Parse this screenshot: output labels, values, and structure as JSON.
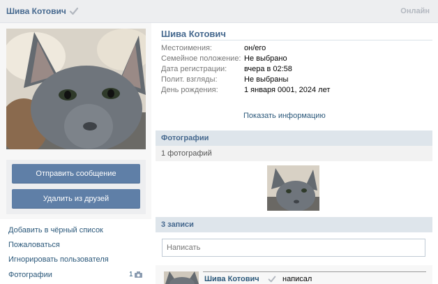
{
  "topbar": {
    "name": "Шива Котович",
    "status": "Онлайн"
  },
  "profile": {
    "name": "Шива Котович",
    "fields": [
      {
        "label": "Местоимения:",
        "value": "он/его"
      },
      {
        "label": "Семейное положение:",
        "value": "Не выбрано"
      },
      {
        "label": "Дата регистрации:",
        "value": "вчера в 02:58"
      },
      {
        "label": "Полит. взгляды:",
        "value": "Не выбраны"
      },
      {
        "label": "День рождения:",
        "value": "1 января 0001, 2024 лет"
      }
    ],
    "show_info": "Показать информацию"
  },
  "actions": {
    "send_message": "Отправить сообщение",
    "remove_friend": "Удалить из друзей"
  },
  "links": {
    "blacklist": "Добавить в чёрный список",
    "report": "Пожаловаться",
    "ignore": "Игнорировать пользователя",
    "photos": "Фотографии",
    "photos_count": "1"
  },
  "photos_section": {
    "title": "Фотографии",
    "count_text": "1 фотографий"
  },
  "wall": {
    "title": "3 записи",
    "composer_placeholder": "Написать",
    "post": {
      "author": "Шива Котович",
      "action": "написал"
    }
  },
  "colors": {
    "accent": "#45688e",
    "button": "#5f7fa7",
    "link": "#2b587a",
    "section": "#dee5eb"
  }
}
